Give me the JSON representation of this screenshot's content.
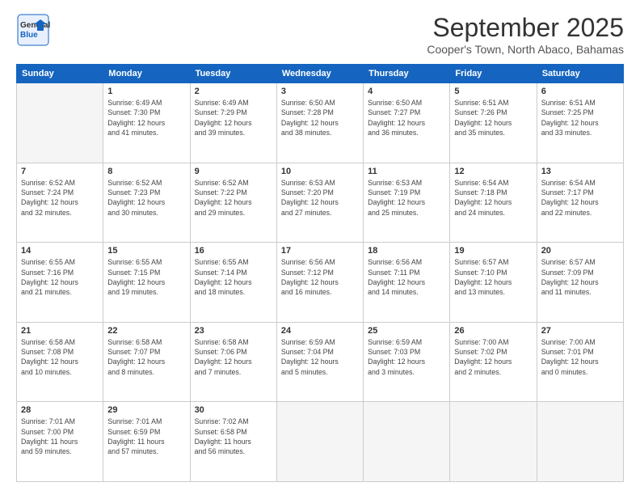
{
  "logo": {
    "line1": "General",
    "line2": "Blue"
  },
  "header": {
    "month": "September 2025",
    "location": "Cooper's Town, North Abaco, Bahamas"
  },
  "days_of_week": [
    "Sunday",
    "Monday",
    "Tuesday",
    "Wednesday",
    "Thursday",
    "Friday",
    "Saturday"
  ],
  "weeks": [
    [
      {
        "day": "",
        "info": ""
      },
      {
        "day": "1",
        "info": "Sunrise: 6:49 AM\nSunset: 7:30 PM\nDaylight: 12 hours\nand 41 minutes."
      },
      {
        "day": "2",
        "info": "Sunrise: 6:49 AM\nSunset: 7:29 PM\nDaylight: 12 hours\nand 39 minutes."
      },
      {
        "day": "3",
        "info": "Sunrise: 6:50 AM\nSunset: 7:28 PM\nDaylight: 12 hours\nand 38 minutes."
      },
      {
        "day": "4",
        "info": "Sunrise: 6:50 AM\nSunset: 7:27 PM\nDaylight: 12 hours\nand 36 minutes."
      },
      {
        "day": "5",
        "info": "Sunrise: 6:51 AM\nSunset: 7:26 PM\nDaylight: 12 hours\nand 35 minutes."
      },
      {
        "day": "6",
        "info": "Sunrise: 6:51 AM\nSunset: 7:25 PM\nDaylight: 12 hours\nand 33 minutes."
      }
    ],
    [
      {
        "day": "7",
        "info": "Sunrise: 6:52 AM\nSunset: 7:24 PM\nDaylight: 12 hours\nand 32 minutes."
      },
      {
        "day": "8",
        "info": "Sunrise: 6:52 AM\nSunset: 7:23 PM\nDaylight: 12 hours\nand 30 minutes."
      },
      {
        "day": "9",
        "info": "Sunrise: 6:52 AM\nSunset: 7:22 PM\nDaylight: 12 hours\nand 29 minutes."
      },
      {
        "day": "10",
        "info": "Sunrise: 6:53 AM\nSunset: 7:20 PM\nDaylight: 12 hours\nand 27 minutes."
      },
      {
        "day": "11",
        "info": "Sunrise: 6:53 AM\nSunset: 7:19 PM\nDaylight: 12 hours\nand 25 minutes."
      },
      {
        "day": "12",
        "info": "Sunrise: 6:54 AM\nSunset: 7:18 PM\nDaylight: 12 hours\nand 24 minutes."
      },
      {
        "day": "13",
        "info": "Sunrise: 6:54 AM\nSunset: 7:17 PM\nDaylight: 12 hours\nand 22 minutes."
      }
    ],
    [
      {
        "day": "14",
        "info": "Sunrise: 6:55 AM\nSunset: 7:16 PM\nDaylight: 12 hours\nand 21 minutes."
      },
      {
        "day": "15",
        "info": "Sunrise: 6:55 AM\nSunset: 7:15 PM\nDaylight: 12 hours\nand 19 minutes."
      },
      {
        "day": "16",
        "info": "Sunrise: 6:55 AM\nSunset: 7:14 PM\nDaylight: 12 hours\nand 18 minutes."
      },
      {
        "day": "17",
        "info": "Sunrise: 6:56 AM\nSunset: 7:12 PM\nDaylight: 12 hours\nand 16 minutes."
      },
      {
        "day": "18",
        "info": "Sunrise: 6:56 AM\nSunset: 7:11 PM\nDaylight: 12 hours\nand 14 minutes."
      },
      {
        "day": "19",
        "info": "Sunrise: 6:57 AM\nSunset: 7:10 PM\nDaylight: 12 hours\nand 13 minutes."
      },
      {
        "day": "20",
        "info": "Sunrise: 6:57 AM\nSunset: 7:09 PM\nDaylight: 12 hours\nand 11 minutes."
      }
    ],
    [
      {
        "day": "21",
        "info": "Sunrise: 6:58 AM\nSunset: 7:08 PM\nDaylight: 12 hours\nand 10 minutes."
      },
      {
        "day": "22",
        "info": "Sunrise: 6:58 AM\nSunset: 7:07 PM\nDaylight: 12 hours\nand 8 minutes."
      },
      {
        "day": "23",
        "info": "Sunrise: 6:58 AM\nSunset: 7:06 PM\nDaylight: 12 hours\nand 7 minutes."
      },
      {
        "day": "24",
        "info": "Sunrise: 6:59 AM\nSunset: 7:04 PM\nDaylight: 12 hours\nand 5 minutes."
      },
      {
        "day": "25",
        "info": "Sunrise: 6:59 AM\nSunset: 7:03 PM\nDaylight: 12 hours\nand 3 minutes."
      },
      {
        "day": "26",
        "info": "Sunrise: 7:00 AM\nSunset: 7:02 PM\nDaylight: 12 hours\nand 2 minutes."
      },
      {
        "day": "27",
        "info": "Sunrise: 7:00 AM\nSunset: 7:01 PM\nDaylight: 12 hours\nand 0 minutes."
      }
    ],
    [
      {
        "day": "28",
        "info": "Sunrise: 7:01 AM\nSunset: 7:00 PM\nDaylight: 11 hours\nand 59 minutes."
      },
      {
        "day": "29",
        "info": "Sunrise: 7:01 AM\nSunset: 6:59 PM\nDaylight: 11 hours\nand 57 minutes."
      },
      {
        "day": "30",
        "info": "Sunrise: 7:02 AM\nSunset: 6:58 PM\nDaylight: 11 hours\nand 56 minutes."
      },
      {
        "day": "",
        "info": ""
      },
      {
        "day": "",
        "info": ""
      },
      {
        "day": "",
        "info": ""
      },
      {
        "day": "",
        "info": ""
      }
    ]
  ]
}
